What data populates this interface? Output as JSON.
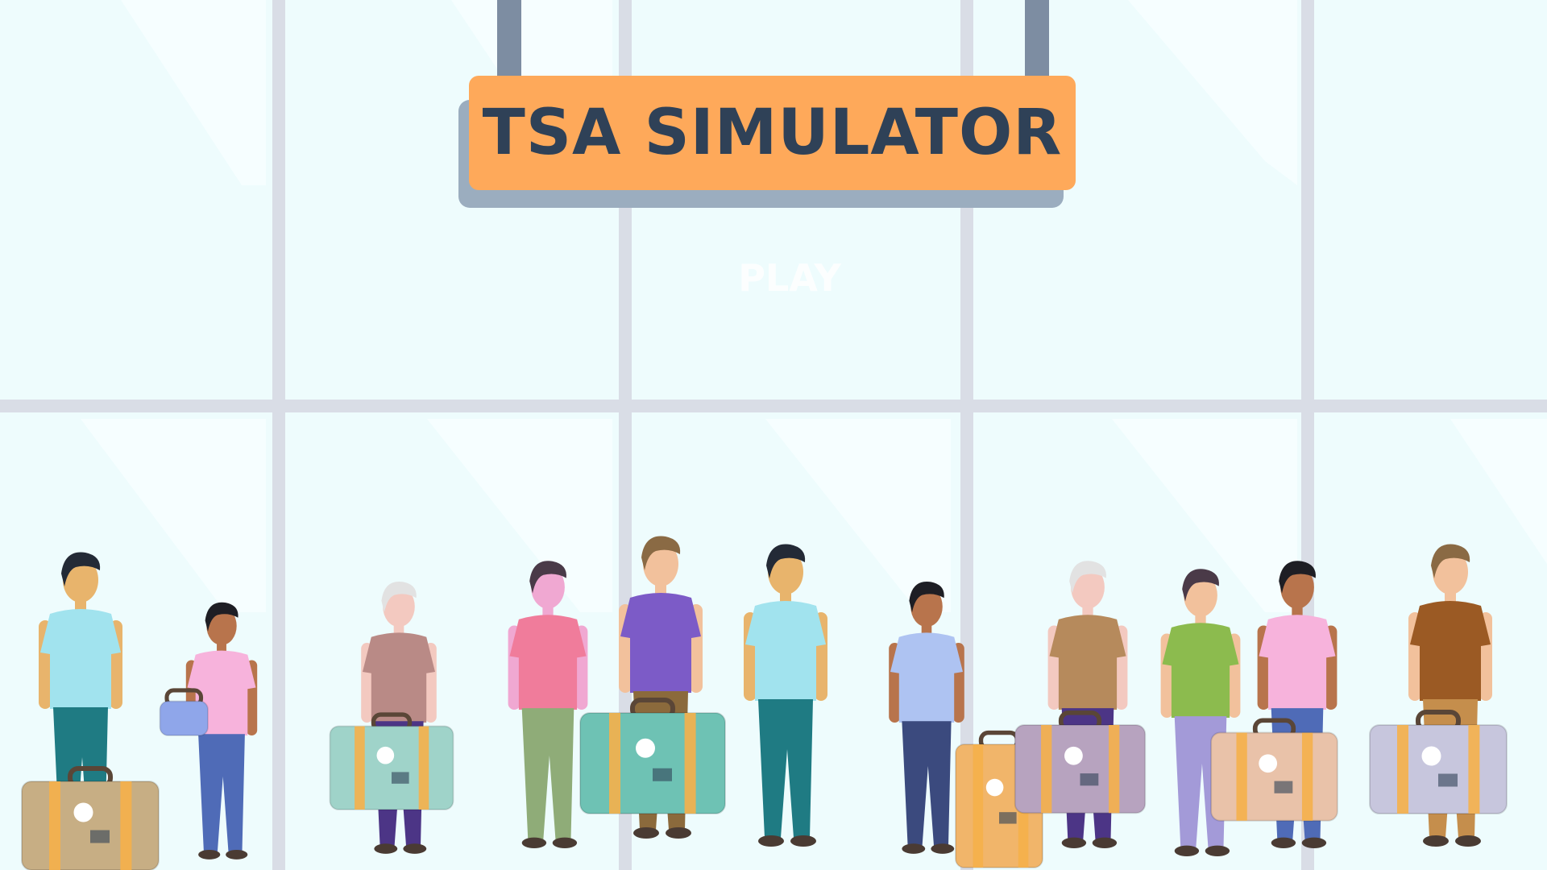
{
  "app": {
    "title": "TSA SIMULATOR",
    "play_label": "PLAY"
  },
  "colors": {
    "background": "#eefcfd",
    "window_frame": "#d9dde6",
    "sign_orange": "#fea95a",
    "sign_shadow": "#9badbf",
    "sign_post": "#7d8da2",
    "title_text": "#2f4157",
    "play_text": "#ffffff"
  },
  "travelers": [
    {
      "icon": "traveler-man-cyan-shirt-icon",
      "shirt": "#a1e3ee",
      "pants": "#1f7b83",
      "skin": "#e8b46c",
      "hair": "#232a36",
      "bag": "vintage-brown-suitcase-icon",
      "bag_color": "#c7ae84"
    },
    {
      "icon": "traveler-woman-pink-top-icon",
      "shirt": "#f7b3dc",
      "pants": "#4f6bb7",
      "skin": "#b8744c",
      "hair": "#1e1e24",
      "bag": "folder-icon",
      "bag_color": "#8fa6ea"
    },
    {
      "icon": "traveler-elderly-man-icon",
      "shirt": "#b98a86",
      "pants": "#4c3586",
      "skin": "#f3c9c0",
      "hair": "#e2e2e2",
      "bag": "mint-suitcase-icon",
      "bag_color": "#9fd3c9"
    },
    {
      "icon": "traveler-woman-phone-icon",
      "shirt": "#f07c9b",
      "pants": "#8fac78",
      "skin": "#f0a8d2",
      "hair": "#4a3a48",
      "bag": "none",
      "bag_color": ""
    },
    {
      "icon": "traveler-bearded-man-purple-icon",
      "shirt": "#7c5bc7",
      "pants": "#8b6a3c",
      "skin": "#f2c19c",
      "hair": "#8a6a44",
      "bag": "teal-sticker-suitcase-icon",
      "bag_color": "#6ec2b4"
    },
    {
      "icon": "traveler-man-cyan-shirt-2-icon",
      "shirt": "#a1e3ee",
      "pants": "#1f7b83",
      "skin": "#e8b46c",
      "hair": "#232a36",
      "bag": "none",
      "bag_color": ""
    },
    {
      "icon": "traveler-woman-lavender-icon",
      "shirt": "#aec3f2",
      "pants": "#3b4a7e",
      "skin": "#b8744c",
      "hair": "#1e1e24",
      "bag": "orange-rolling-suitcase-icon",
      "bag_color": "#f1b56a"
    },
    {
      "icon": "traveler-elderly-man-2-icon",
      "shirt": "#b68a5c",
      "pants": "#4c3586",
      "skin": "#f3c9c0",
      "hair": "#e2e2e2",
      "bag": "lilac-suitcase-icon",
      "bag_color": "#b7a3bf"
    },
    {
      "icon": "traveler-woman-green-icon",
      "shirt": "#8cbb4e",
      "pants": "#a39ad8",
      "skin": "#f2c19c",
      "hair": "#4a3a48",
      "bag": "none",
      "bag_color": ""
    },
    {
      "icon": "traveler-woman-pink-top-2-icon",
      "shirt": "#f7b3dc",
      "pants": "#4f6bb7",
      "skin": "#b8744c",
      "hair": "#1e1e24",
      "bag": "peach-suitcase-icon",
      "bag_color": "#e9c2a9"
    },
    {
      "icon": "traveler-bearded-man-brown-icon",
      "shirt": "#9b5a24",
      "pants": "#c58e4c",
      "skin": "#f2c19c",
      "hair": "#8a6a44",
      "bag": "grey-suitcase-icon",
      "bag_color": "#c7c6dd"
    }
  ]
}
